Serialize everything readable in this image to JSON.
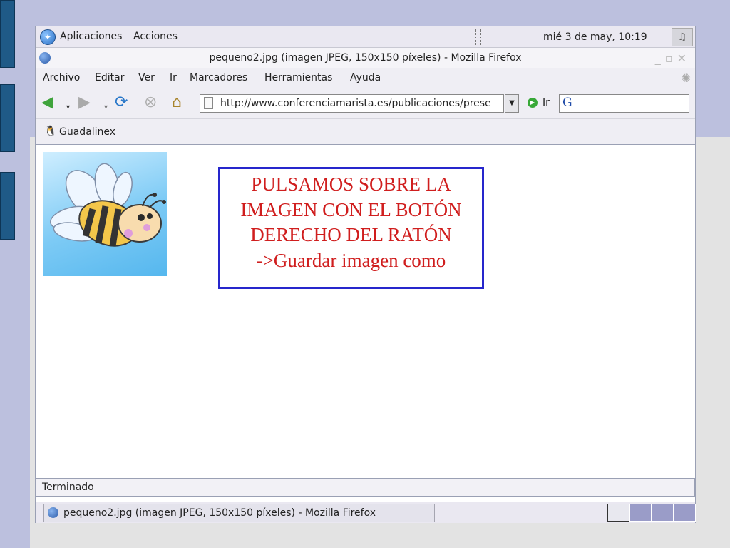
{
  "panel": {
    "applications_label": "Aplicaciones",
    "actions_label": "Acciones",
    "clock": "mié  3 de may, 10:19"
  },
  "window": {
    "title": "pequeno2.jpg (imagen JPEG, 150x150 píxeles) - Mozilla Firefox"
  },
  "menu": {
    "items": [
      "Archivo",
      "Editar",
      "Ver",
      "Ir",
      "Marcadores",
      "Herramientas",
      "Ayuda"
    ]
  },
  "navigation": {
    "url": "http://www.conferenciamarista.es/publicaciones/prese",
    "go_label": "Ir",
    "search_engine_letter": "G"
  },
  "bookmarks": {
    "items": [
      "Guadalinex"
    ]
  },
  "callout": {
    "lines": [
      "PULSAMOS SOBRE LA",
      "IMAGEN CON EL BOTÓN",
      "DERECHO DEL RATÓN",
      "->Guardar imagen como"
    ]
  },
  "status": {
    "text": "Terminado"
  },
  "taskbar": {
    "task_label": "pequeno2.jpg (imagen JPEG, 150x150 píxeles) - Mozilla Firefox"
  },
  "icons": {
    "back": "back-arrow-icon",
    "forward": "forward-arrow-icon",
    "reload": "reload-icon",
    "stop": "stop-icon",
    "home": "home-icon",
    "page": "page-icon",
    "go": "go-icon",
    "bookmark": "penguin-icon",
    "sound": "speaker-icon"
  },
  "colors": {
    "callout_text": "#d01e1e",
    "callout_border": "#2626cc",
    "desktop_background": "#bcc0de",
    "sidebar_bars": "#1f5a87"
  }
}
